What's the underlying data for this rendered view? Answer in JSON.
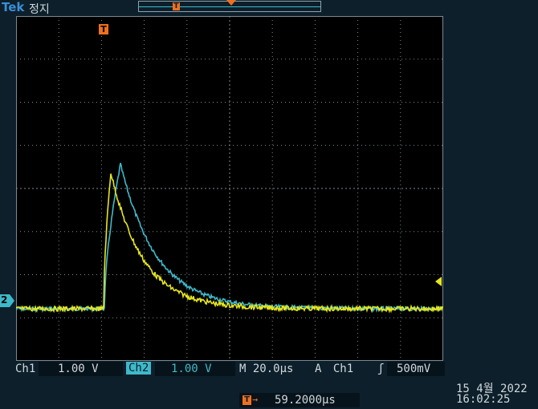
{
  "brand": "Tek",
  "status": "정지",
  "markers": {
    "trigger_letter": "T",
    "ch2_ground": "2"
  },
  "channels": {
    "ch1": {
      "name": "Ch1",
      "scale": "1.00 V",
      "color": "#e6e61e"
    },
    "ch2": {
      "name": "Ch2",
      "scale": "1.00 V",
      "color": "#3fb9c9"
    }
  },
  "timebase": "M 20.0µs",
  "trigger": {
    "mode": "A",
    "source": "Ch1",
    "slope_icon": "rising-edge-icon",
    "slope_glyph": "ʃ",
    "level": "500mV",
    "position": "59.2000µs",
    "color": "#f0701e"
  },
  "datetime": {
    "date": "15 4월  2022",
    "time": "16:02:25"
  }
}
